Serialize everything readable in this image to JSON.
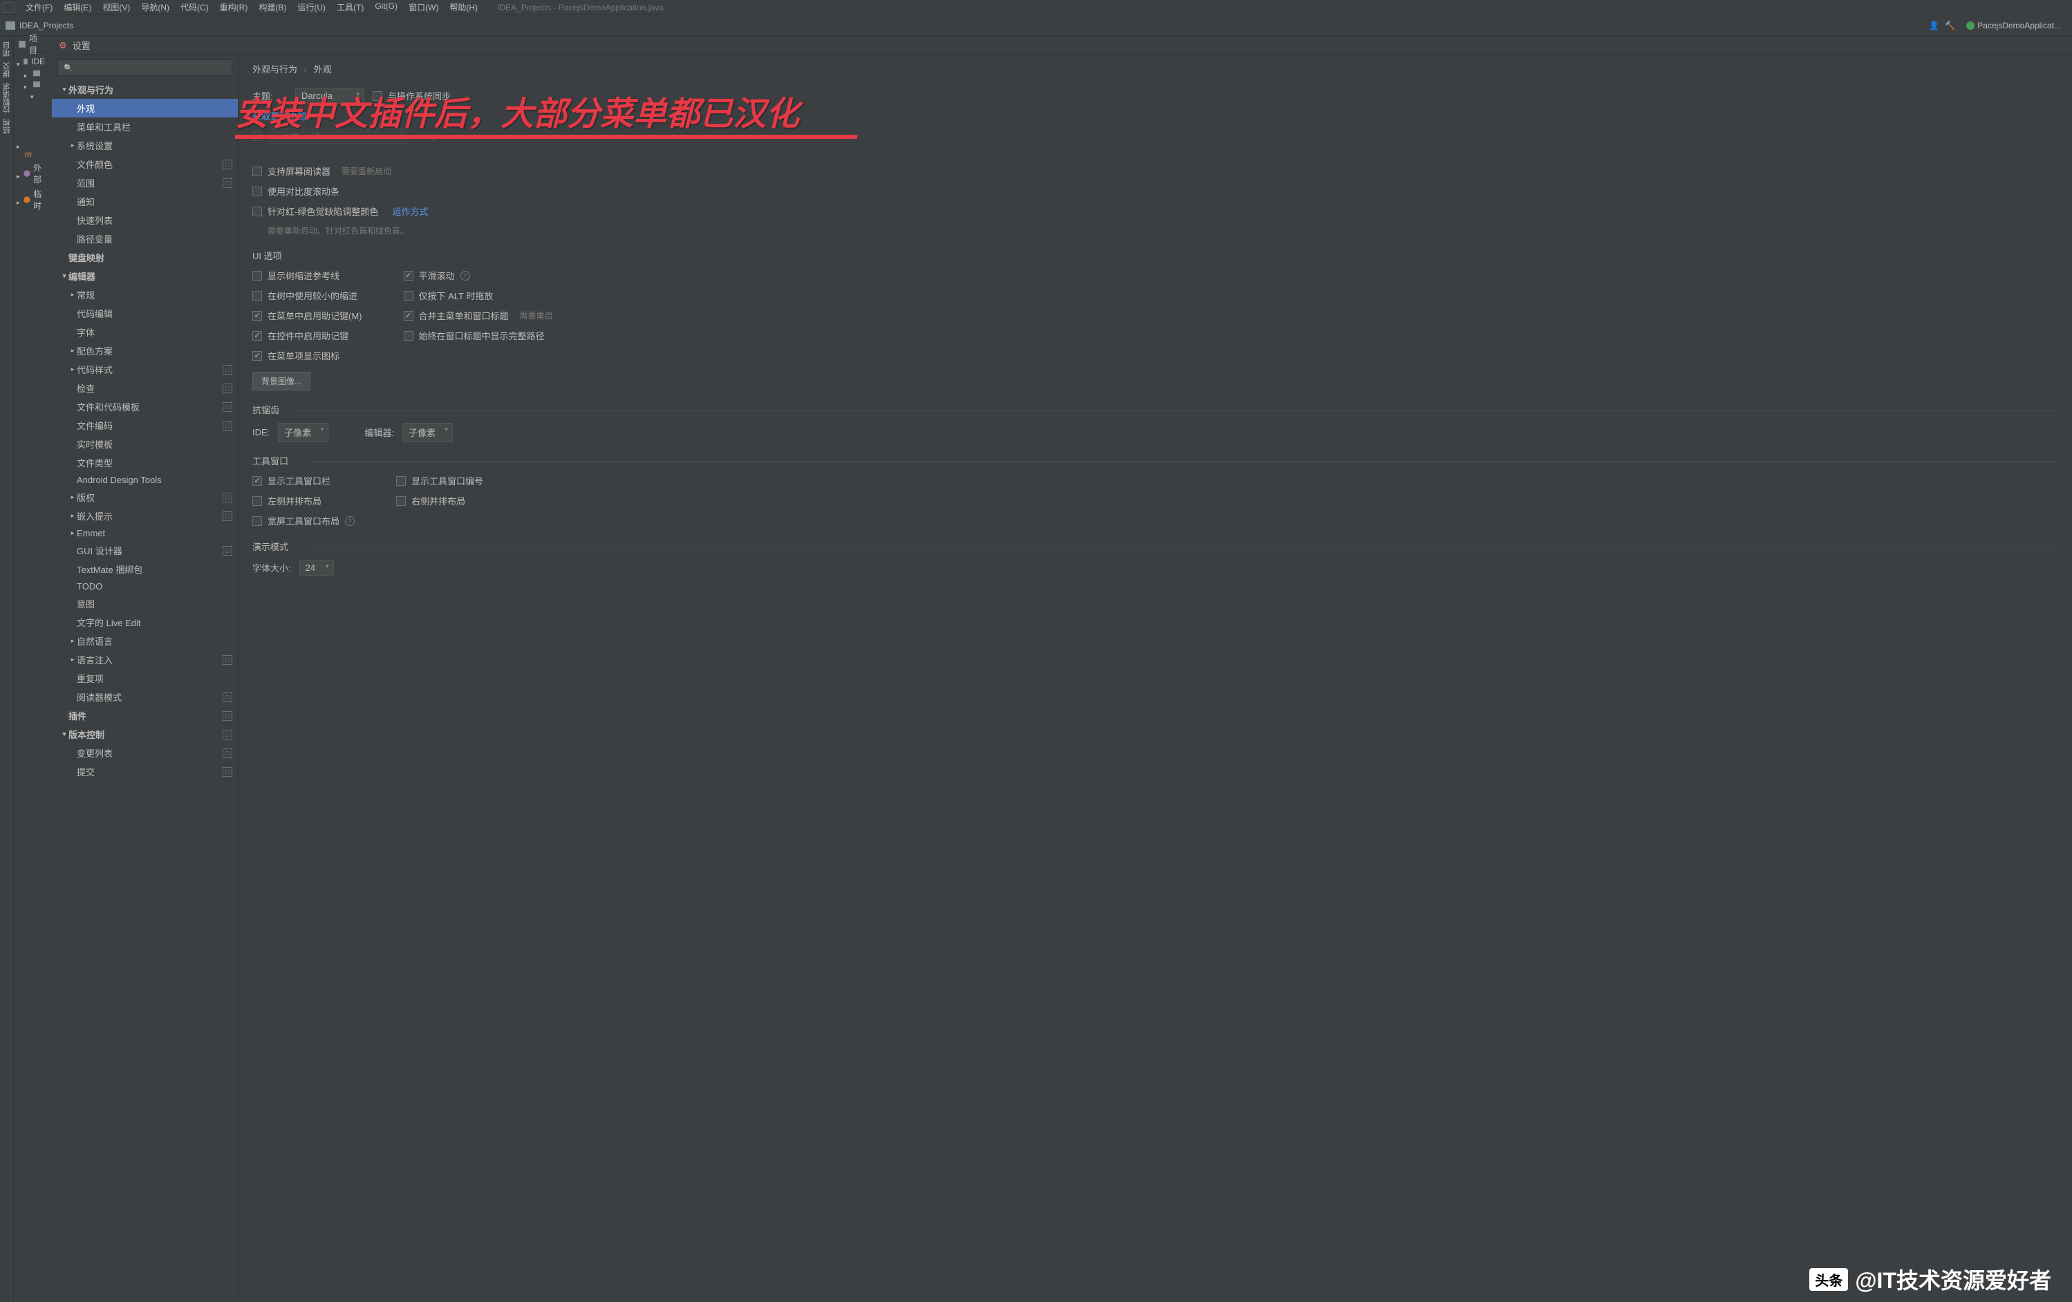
{
  "menubar": {
    "items": [
      "文件(F)",
      "编辑(E)",
      "视图(V)",
      "导航(N)",
      "代码(C)",
      "重构(R)",
      "构建(B)",
      "运行(U)",
      "工具(T)",
      "Git(G)",
      "窗口(W)",
      "帮助(H)"
    ],
    "title": "IDEA_Projects - PacejsDemoApplication.java"
  },
  "toolbar": {
    "project": "IDEA_Projects",
    "run_config": "PacejsDemoApplicat..."
  },
  "left_gutter": [
    "项目",
    "提交",
    "拉取请求",
    "结构"
  ],
  "project_panel": {
    "header": "项目",
    "root": "IDE..."
  },
  "tree_nodes": [
    "IDE",
    "外部",
    "临时"
  ],
  "dialog": {
    "title": "设置"
  },
  "settings_tree": [
    {
      "label": "外观与行为",
      "depth": 1,
      "caret": "down",
      "selected": false
    },
    {
      "label": "外观",
      "depth": 2,
      "caret": "none",
      "selected": true
    },
    {
      "label": "菜单和工具栏",
      "depth": 2,
      "caret": "none"
    },
    {
      "label": "系统设置",
      "depth": 2,
      "caret": "right"
    },
    {
      "label": "文件颜色",
      "depth": 2,
      "caret": "none",
      "badge": true
    },
    {
      "label": "范围",
      "depth": 2,
      "caret": "none",
      "badge": true
    },
    {
      "label": "通知",
      "depth": 2,
      "caret": "none"
    },
    {
      "label": "快速列表",
      "depth": 2,
      "caret": "none"
    },
    {
      "label": "路径变量",
      "depth": 2,
      "caret": "none"
    },
    {
      "label": "键盘映射",
      "depth": 1,
      "caret": "none",
      "hdr": true
    },
    {
      "label": "编辑器",
      "depth": 1,
      "caret": "down"
    },
    {
      "label": "常规",
      "depth": 2,
      "caret": "right"
    },
    {
      "label": "代码编辑",
      "depth": 2,
      "caret": "none"
    },
    {
      "label": "字体",
      "depth": 2,
      "caret": "none"
    },
    {
      "label": "配色方案",
      "depth": 2,
      "caret": "right"
    },
    {
      "label": "代码样式",
      "depth": 2,
      "caret": "right",
      "badge": true
    },
    {
      "label": "检查",
      "depth": 2,
      "caret": "none",
      "badge": true
    },
    {
      "label": "文件和代码模板",
      "depth": 2,
      "caret": "none",
      "badge": true
    },
    {
      "label": "文件编码",
      "depth": 2,
      "caret": "none",
      "badge": true
    },
    {
      "label": "实时模板",
      "depth": 2,
      "caret": "none"
    },
    {
      "label": "文件类型",
      "depth": 2,
      "caret": "none"
    },
    {
      "label": "Android Design Tools",
      "depth": 2,
      "caret": "none"
    },
    {
      "label": "版权",
      "depth": 2,
      "caret": "right",
      "badge": true
    },
    {
      "label": "嵌入提示",
      "depth": 2,
      "caret": "right",
      "badge": true
    },
    {
      "label": "Emmet",
      "depth": 2,
      "caret": "right"
    },
    {
      "label": "GUI 设计器",
      "depth": 2,
      "caret": "none",
      "badge": true
    },
    {
      "label": "TextMate 捆绑包",
      "depth": 2,
      "caret": "none"
    },
    {
      "label": "TODO",
      "depth": 2,
      "caret": "none"
    },
    {
      "label": "意图",
      "depth": 2,
      "caret": "none"
    },
    {
      "label": "文字的 Live Edit",
      "depth": 2,
      "caret": "none"
    },
    {
      "label": "自然语言",
      "depth": 2,
      "caret": "right"
    },
    {
      "label": "语言注入",
      "depth": 2,
      "caret": "right",
      "badge": true
    },
    {
      "label": "重复项",
      "depth": 2,
      "caret": "none"
    },
    {
      "label": "阅读器模式",
      "depth": 2,
      "caret": "none",
      "badge": true
    },
    {
      "label": "插件",
      "depth": 1,
      "caret": "none",
      "hdr": true,
      "badge": true
    },
    {
      "label": "版本控制",
      "depth": 1,
      "caret": "down",
      "badge": true
    },
    {
      "label": "变更列表",
      "depth": 2,
      "caret": "none",
      "badge": true
    },
    {
      "label": "提交",
      "depth": 2,
      "caret": "none",
      "badge": true
    }
  ],
  "content": {
    "breadcrumb": {
      "group": "外观与行为",
      "page": "外观"
    },
    "theme_label": "主题:",
    "theme_value": "Darcula",
    "sync_os": "与操作系统同步",
    "more_themes": "获取更多主题",
    "font_value": "...soft.... UI",
    "accessibility": {
      "screen_reader": "支持屏幕阅读器",
      "restart_needed": "需要重新启动",
      "contrast_scroll": "使用对比度滚动条",
      "colorblind": "针对红-绿色觉缺陷调整颜色",
      "how_link": "运作方式",
      "colorblind_hint": "需要重新启动。针对红色盲和绿色盲。"
    },
    "ui_options": {
      "title": "UI 选项",
      "tree_indent_guides": "显示树缩进参考线",
      "smooth_scroll": "平滑滚动",
      "small_tree_indent": "在树中使用较小的缩进",
      "alt_drag": "仅按下 ALT 时拖放",
      "mnemonics_menu": "在菜单中启用助记键(M)",
      "merge_main_menu": "合并主菜单和窗口标题",
      "restart_hint": "需要重启",
      "mnemonics_controls": "在控件中启用助记键",
      "full_path_title": "始终在窗口标题中显示完整路径",
      "menu_icons": "在菜单项显示图标",
      "bg_image_btn": "背景图像..."
    },
    "antialiasing": {
      "title": "抗锯齿",
      "ide_label": "IDE:",
      "ide_value": "子像素",
      "editor_label": "编辑器:",
      "editor_value": "子像素"
    },
    "tool_windows": {
      "title": "工具窗口",
      "show_bars": "显示工具窗口栏",
      "show_numbers": "显示工具窗口编号",
      "left_layout": "左侧并排布局",
      "right_layout": "右侧并排布局",
      "wide_layout": "宽屏工具窗口布局"
    },
    "presentation": {
      "title": "演示模式",
      "font_size_label": "字体大小:",
      "font_size_value": "24"
    }
  },
  "overlay_text": "安装中文插件后，大部分菜单都已汉化",
  "watermark": {
    "logo": "头条",
    "text": "@IT技术资源爱好者"
  }
}
